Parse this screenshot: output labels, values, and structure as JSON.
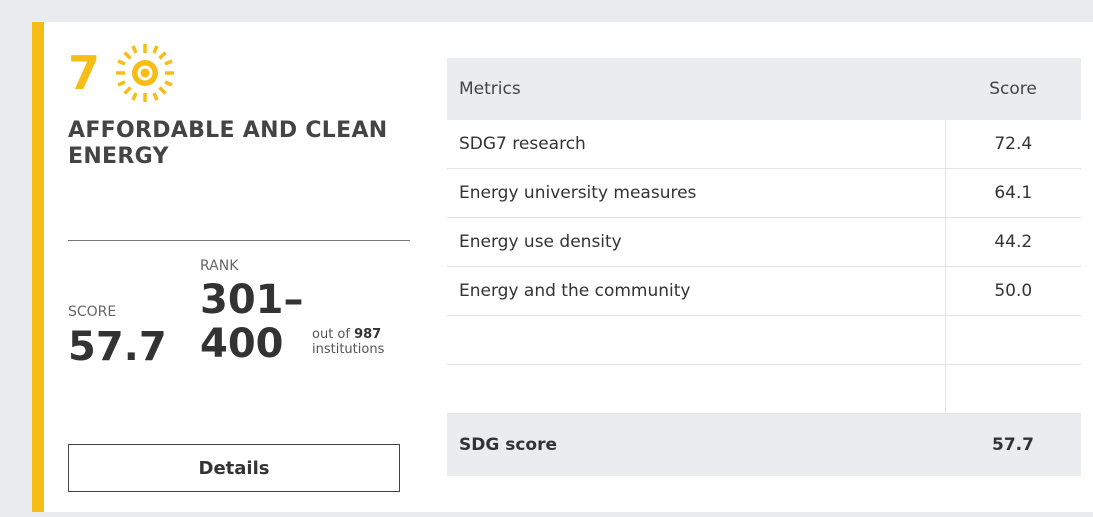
{
  "sdg": {
    "number": "7",
    "icon": "sun-icon",
    "title": "AFFORDABLE AND CLEAN ENERGY",
    "accent_color": "#f6bd16"
  },
  "summary": {
    "score_label": "SCORE",
    "score_value": "57.7",
    "rank_label": "RANK",
    "rank_value": "301–400",
    "out_of_prefix": "out of",
    "out_of_count": "987",
    "out_of_suffix": "institutions"
  },
  "details_button": {
    "label": "Details"
  },
  "table": {
    "headers": {
      "metric": "Metrics",
      "score": "Score"
    },
    "rows": [
      {
        "metric": "SDG7 research",
        "score": "72.4"
      },
      {
        "metric": "Energy university measures",
        "score": "64.1"
      },
      {
        "metric": "Energy use density",
        "score": "44.2"
      },
      {
        "metric": "Energy and the community",
        "score": "50.0"
      },
      {
        "metric": "",
        "score": ""
      },
      {
        "metric": "",
        "score": ""
      }
    ],
    "total": {
      "metric": "SDG score",
      "score": "57.7"
    }
  }
}
